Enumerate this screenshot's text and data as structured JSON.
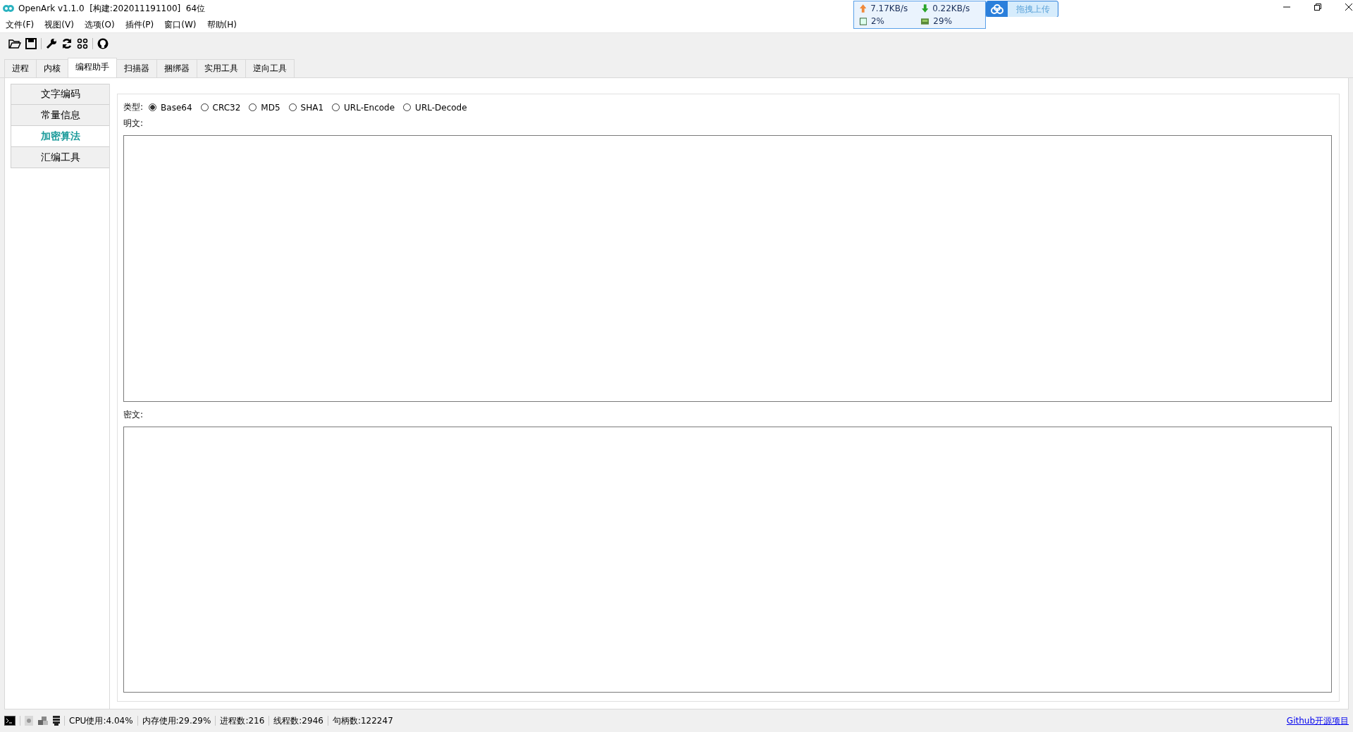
{
  "window": {
    "title": "OpenArk v1.1.0  [构建:202011191100]  64位"
  },
  "net_monitor": {
    "upload": "7.17KB/s",
    "download": "0.22KB/s",
    "cpu": "2%",
    "memory": "29%"
  },
  "upload_button": {
    "label": "拖拽上传"
  },
  "menu": [
    "文件(F)",
    "视图(V)",
    "选项(O)",
    "插件(P)",
    "窗口(W)",
    "帮助(H)"
  ],
  "tabs": [
    {
      "label": "进程",
      "selected": false
    },
    {
      "label": "内核",
      "selected": false
    },
    {
      "label": "编程助手",
      "selected": true
    },
    {
      "label": "扫描器",
      "selected": false
    },
    {
      "label": "捆绑器",
      "selected": false
    },
    {
      "label": "实用工具",
      "selected": false
    },
    {
      "label": "逆向工具",
      "selected": false
    }
  ],
  "sidebar": {
    "items": [
      {
        "label": "文字编码",
        "selected": false
      },
      {
        "label": "常量信息",
        "selected": false
      },
      {
        "label": "加密算法",
        "selected": true
      },
      {
        "label": "汇编工具",
        "selected": false
      }
    ]
  },
  "type_label": "类型:",
  "types": [
    {
      "label": "Base64",
      "selected": true
    },
    {
      "label": "CRC32",
      "selected": false
    },
    {
      "label": "MD5",
      "selected": false
    },
    {
      "label": "SHA1",
      "selected": false
    },
    {
      "label": "URL-Encode",
      "selected": false
    },
    {
      "label": "URL-Decode",
      "selected": false
    }
  ],
  "plaintext": {
    "label": "明文:"
  },
  "ciphertext": {
    "label": "密文:"
  },
  "status_bar": {
    "items": [
      "CPU使用:4.04%",
      "内存使用:29.29%",
      "进程数:216",
      "线程数:2946",
      "句柄数:122247"
    ],
    "link": "Github开源项目"
  }
}
